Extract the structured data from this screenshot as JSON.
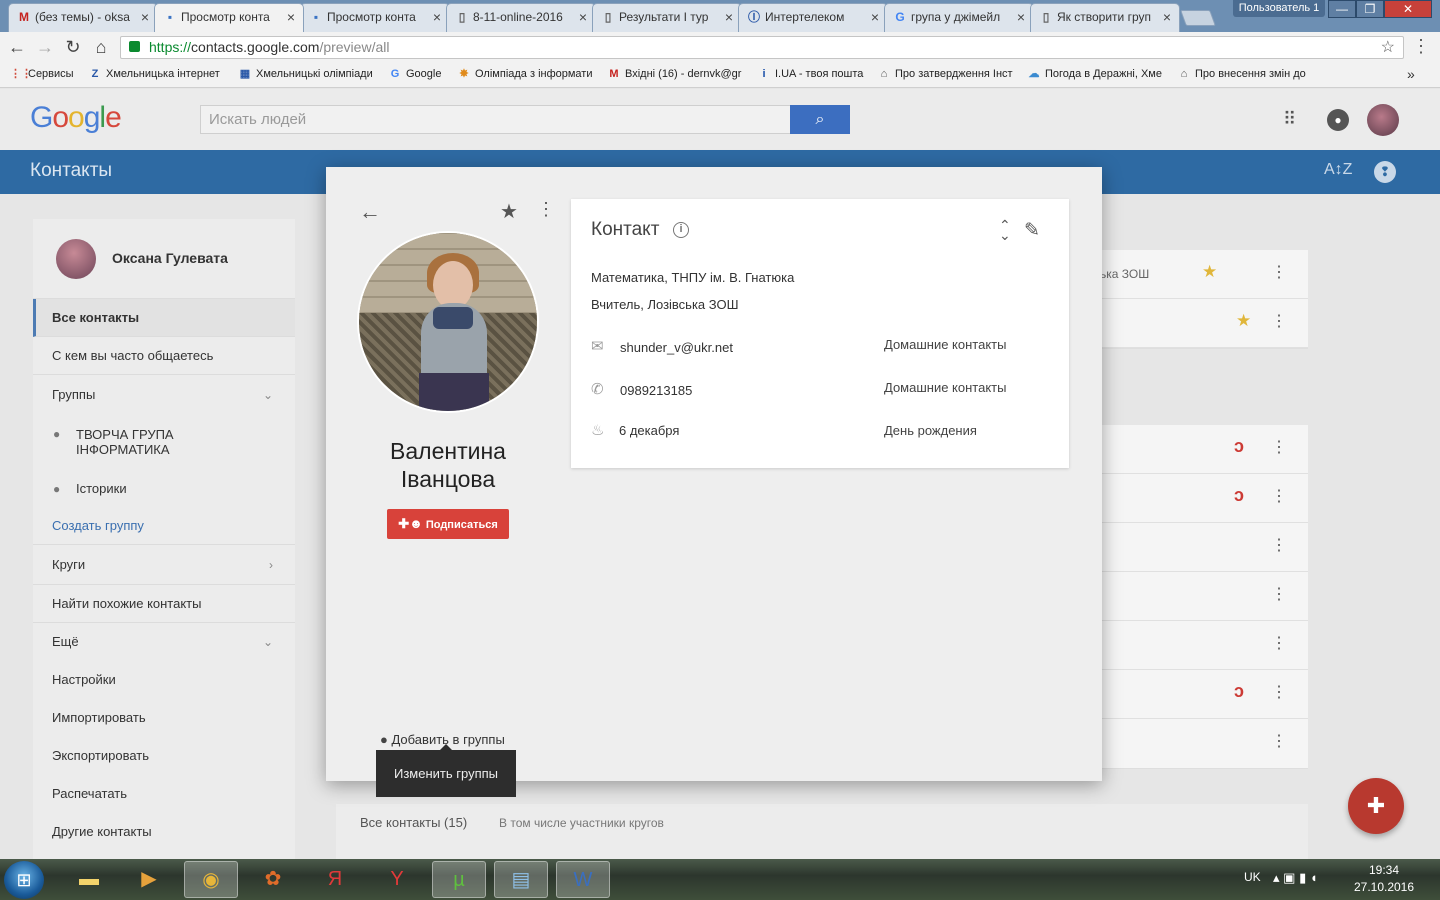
{
  "browser": {
    "tabs": [
      {
        "favicon": "gmail-icon",
        "glyph": "M",
        "color": "#c5221f",
        "label": "(без темы) - oksa"
      },
      {
        "favicon": "contacts-icon",
        "glyph": "▪",
        "color": "#3a73c4",
        "label": "Просмотр конта"
      },
      {
        "favicon": "contacts-icon",
        "glyph": "▪",
        "color": "#3a73c4",
        "label": "Просмотр конта"
      },
      {
        "favicon": "document-icon",
        "glyph": "▯",
        "color": "#666",
        "label": "8-11-online-2016"
      },
      {
        "favicon": "document-icon",
        "glyph": "▯",
        "color": "#666",
        "label": "Результати І тур"
      },
      {
        "favicon": "intertelecom-icon",
        "glyph": "Ⓘ",
        "color": "#2a58a8",
        "label": "Интертелеком"
      },
      {
        "favicon": "google-icon",
        "glyph": "G",
        "color": "#4285f4",
        "label": "група у джімейл"
      },
      {
        "favicon": "document-icon",
        "glyph": "▯",
        "color": "#666",
        "label": "Як створити груп"
      }
    ],
    "user_button": "Пользователь 1",
    "url_scheme": "https://",
    "url_host": "contacts.google.com",
    "url_path": "/preview/all",
    "bookmarks": [
      {
        "icon": "apps-icon",
        "glyph": "⋮⋮",
        "color": "#d04a3a",
        "label": "Сервисы"
      },
      {
        "icon": "site-icon",
        "glyph": "Z",
        "color": "#2a58a8",
        "label": "Хмельницька інтернет"
      },
      {
        "icon": "site-icon",
        "glyph": "▦",
        "color": "#2a58a8",
        "label": "Хмельницькі олімпіади"
      },
      {
        "icon": "google-icon",
        "glyph": "G",
        "color": "#4285f4",
        "label": "Google"
      },
      {
        "icon": "olympiad-icon",
        "glyph": "✸",
        "color": "#e08a1a",
        "label": "Олімпіада з інформати"
      },
      {
        "icon": "gmail-icon",
        "glyph": "M",
        "color": "#c5221f",
        "label": "Вхідні (16) - dernvk@gr"
      },
      {
        "icon": "iua-icon",
        "glyph": "i",
        "color": "#1a4fa8",
        "label": "I.UA - твоя пошта"
      },
      {
        "icon": "gov-icon",
        "glyph": "⌂",
        "color": "#555",
        "label": "Про затвердження Інст"
      },
      {
        "icon": "weather-icon",
        "glyph": "☁",
        "color": "#3a8ad0",
        "label": "Погода в Деражні, Хме"
      },
      {
        "icon": "gov-icon",
        "glyph": "⌂",
        "color": "#555",
        "label": "Про внесення змін до"
      }
    ]
  },
  "header": {
    "search_placeholder": "Искать людей",
    "app_title": "Контакты"
  },
  "sidebar": {
    "user_name": "Оксана Гулевата",
    "items": [
      {
        "label": "Все контакты"
      },
      {
        "label": "С кем вы часто общаетесь"
      },
      {
        "label": "Группы"
      },
      {
        "label": "ТВОРЧА ГРУПА ІНФОРМАТИКА"
      },
      {
        "label": "Історики"
      },
      {
        "label": "Создать группу"
      },
      {
        "label": "Круги"
      },
      {
        "label": "Найти похожие контакты"
      },
      {
        "label": "Ещё"
      },
      {
        "label": "Настройки"
      },
      {
        "label": "Импортировать"
      },
      {
        "label": "Экспортировать"
      },
      {
        "label": "Распечатать"
      },
      {
        "label": "Другие контакты"
      }
    ]
  },
  "background_list": {
    "row1_text": "ська ЗОШ",
    "all_contacts": "Все контакты (15)",
    "including": "В том числе участники кругов"
  },
  "contact": {
    "name": "Валентина Іванцова",
    "follow_button": "Подписаться",
    "add_to_groups": "Добавить в группы",
    "tooltip": "Изменить группы",
    "card_title": "Контакт",
    "org_line1": "Математика, ТНПУ ім. В. Гнатюка",
    "org_line2": "Вчитель, Лозівська ЗОШ",
    "email": "shunder_v@ukr.net",
    "email_label": "Домашние контакты",
    "phone": "0989213185",
    "phone_label": "Домашние контакты",
    "birthday": "6 декабря",
    "birthday_label": "День рождения"
  },
  "taskbar": {
    "lang": "UK",
    "time": "19:34",
    "date": "27.10.2016"
  }
}
